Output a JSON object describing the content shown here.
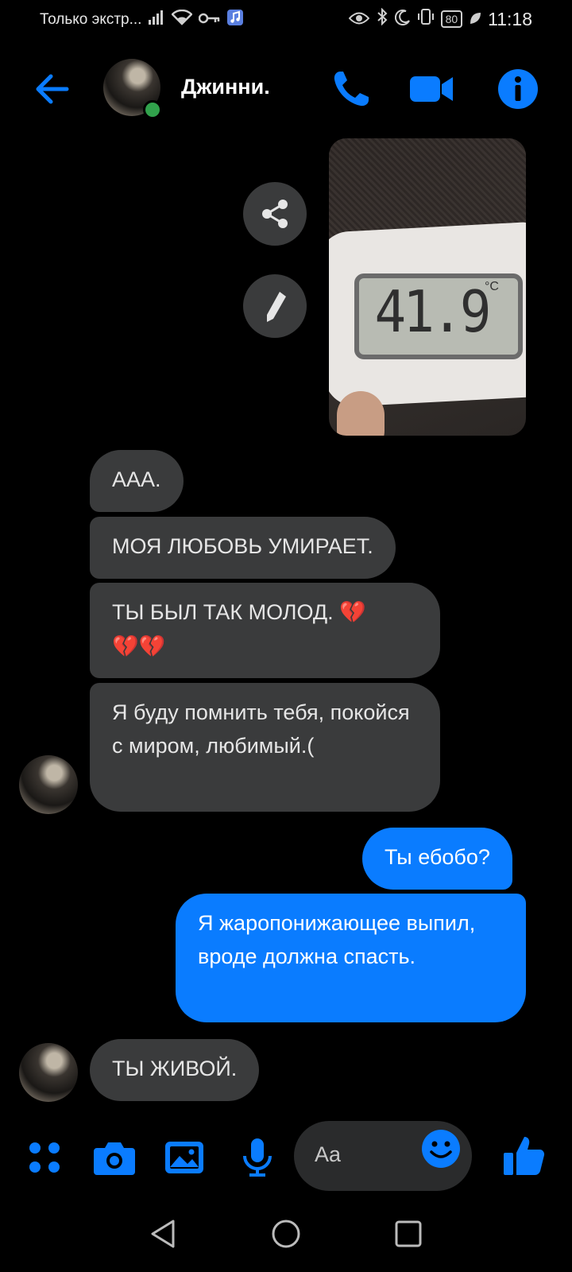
{
  "status_bar": {
    "left_text": "Только экстр...",
    "battery": "80",
    "time": "11:18"
  },
  "header": {
    "contact_name": "Джинни.",
    "icons": [
      "back-arrow",
      "phone",
      "video-camera",
      "info"
    ]
  },
  "image_message": {
    "thermometer_reading": "41.9",
    "unit": "°C",
    "actions": [
      "share",
      "edit"
    ]
  },
  "messages": [
    {
      "direction": "incoming",
      "text": "AAA."
    },
    {
      "direction": "incoming",
      "text": "МОЯ ЛЮБОВЬ УМИРАЕТ."
    },
    {
      "direction": "incoming",
      "text_line1": "ТЫ БЫЛ ТАК МОЛОД. ",
      "text_line2": ""
    },
    {
      "direction": "incoming",
      "text": "Я буду помнить тебя, покойся с миром, любимый.("
    },
    {
      "direction": "outgoing",
      "text": "Ты ебобо?"
    },
    {
      "direction": "outgoing",
      "text": "Я жаропонижающее выпил, вроде должна спасть."
    },
    {
      "direction": "incoming",
      "text": "ТЫ ЖИВОЙ."
    }
  ],
  "composer": {
    "placeholder": "Aa",
    "icons": [
      "menu-dots",
      "camera",
      "gallery",
      "microphone",
      "emoji",
      "thumbs-up"
    ]
  },
  "colors": {
    "accent": "#0A7CFF",
    "incoming_bubble": "#3A3B3C",
    "background": "#000000",
    "online": "#31A24C",
    "heart": "#E5213A"
  }
}
